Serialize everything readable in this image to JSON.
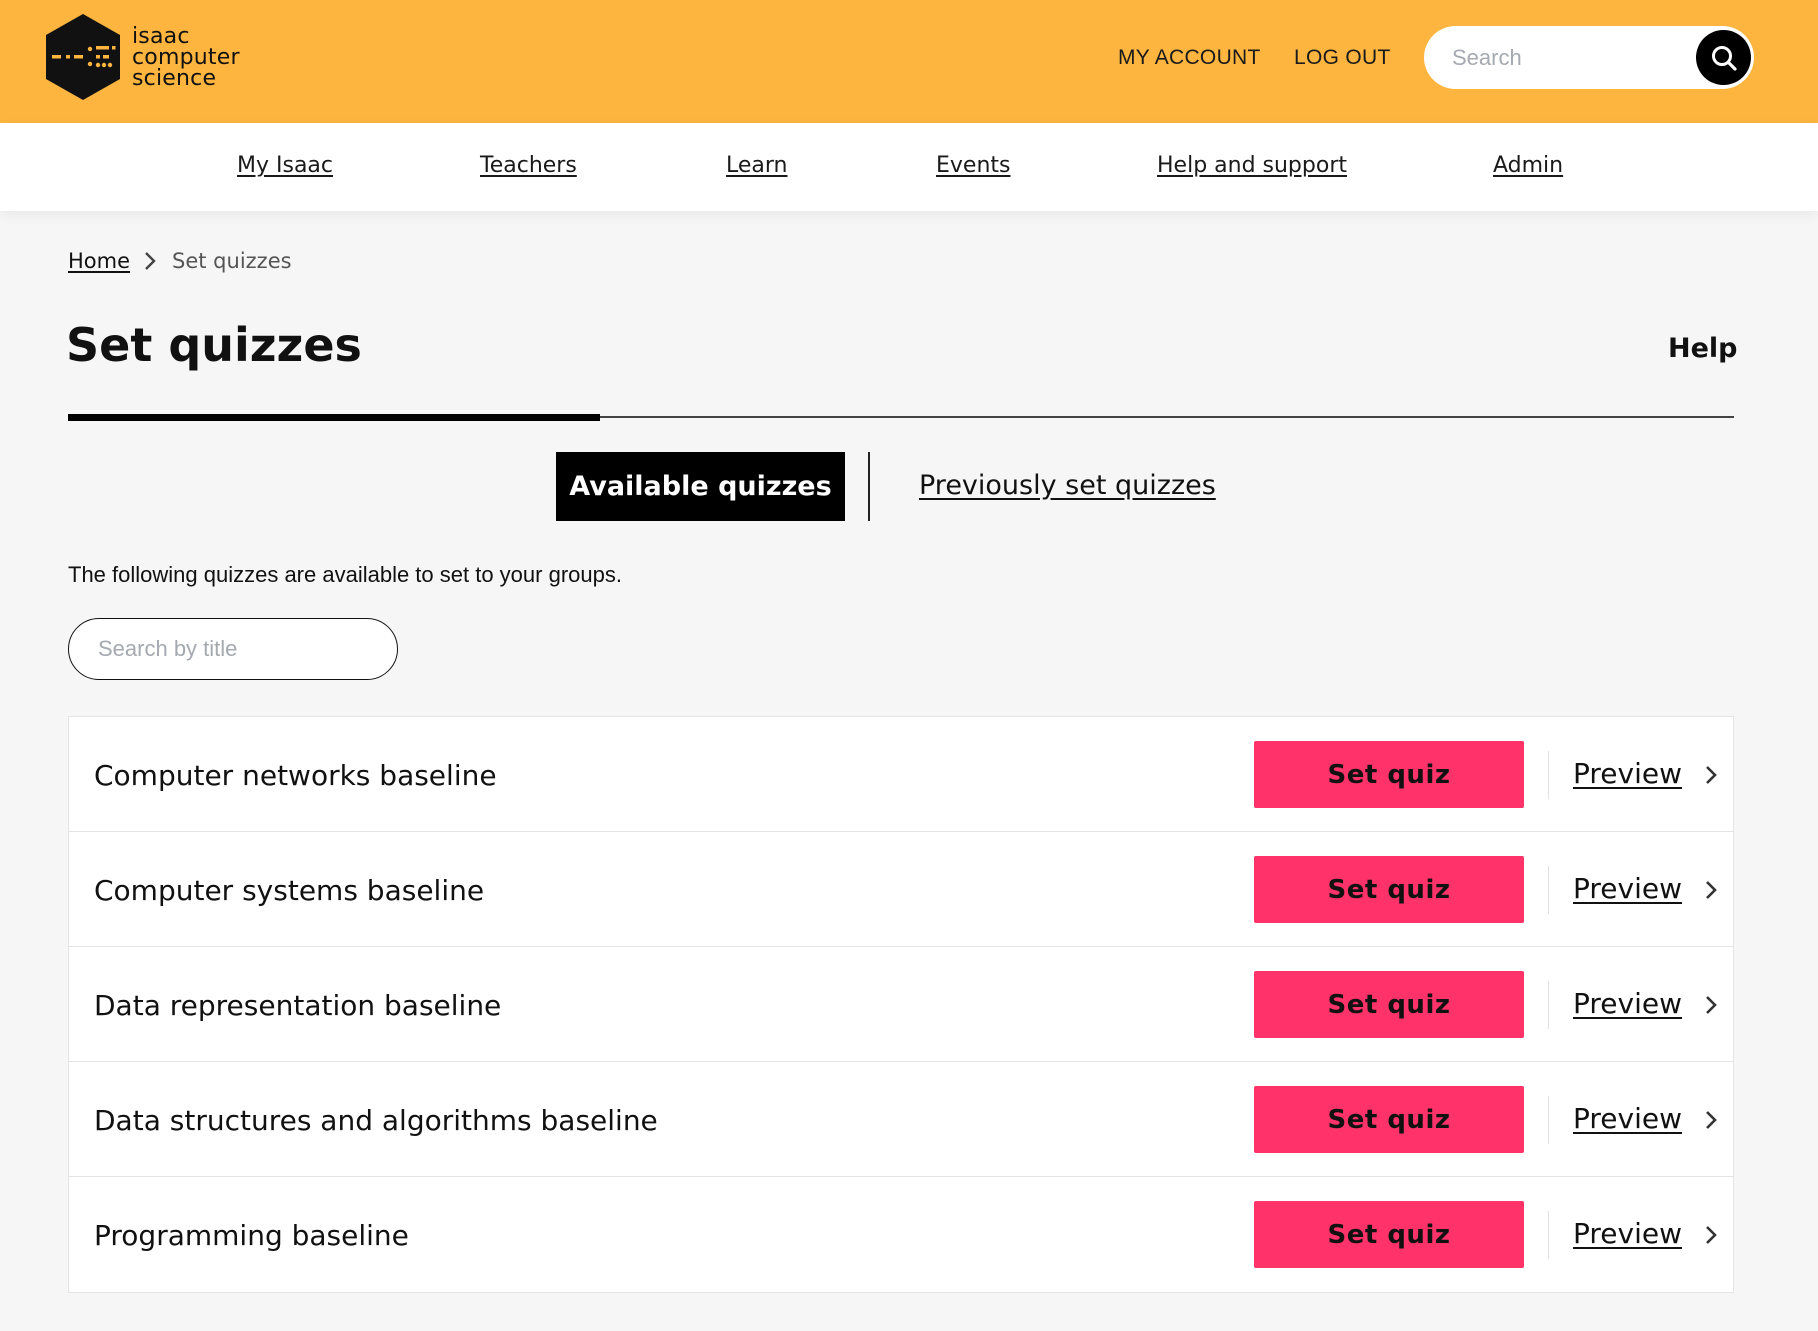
{
  "brand": {
    "logo_lines": [
      "isaac",
      "computer",
      "science"
    ],
    "header_color": "#fdb53f",
    "accent_color": "#ff3369"
  },
  "header": {
    "my_account": "MY ACCOUNT",
    "log_out": "LOG OUT",
    "search_placeholder": "Search",
    "search_icon": "search-icon"
  },
  "nav": {
    "items": [
      {
        "label": "My Isaac"
      },
      {
        "label": "Teachers"
      },
      {
        "label": "Learn"
      },
      {
        "label": "Events"
      },
      {
        "label": "Help and support"
      },
      {
        "label": "Admin"
      }
    ]
  },
  "breadcrumb": {
    "home": "Home",
    "separator_icon": "chevron-right-icon",
    "current": "Set quizzes"
  },
  "page": {
    "title": "Set quizzes",
    "help": "Help"
  },
  "tabs": {
    "active": "Available quizzes",
    "inactive": "Previously set quizzes"
  },
  "main": {
    "intro": "The following quizzes are available to set to your groups.",
    "filter_placeholder": "Search by title"
  },
  "quizzes": [
    {
      "title": "Computer networks baseline",
      "set_label": "Set quiz",
      "preview_label": "Preview"
    },
    {
      "title": "Computer systems baseline",
      "set_label": "Set quiz",
      "preview_label": "Preview"
    },
    {
      "title": "Data representation baseline",
      "set_label": "Set quiz",
      "preview_label": "Preview"
    },
    {
      "title": "Data structures and algorithms baseline",
      "set_label": "Set quiz",
      "preview_label": "Preview"
    },
    {
      "title": "Programming baseline",
      "set_label": "Set quiz",
      "preview_label": "Preview"
    }
  ]
}
